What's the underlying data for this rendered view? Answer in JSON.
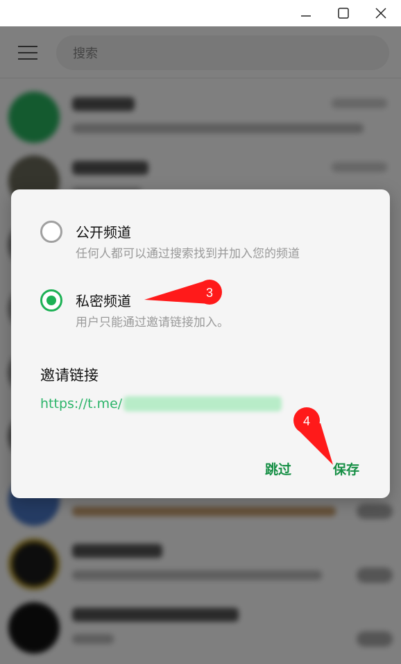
{
  "window": {
    "minimize_glyph": "—",
    "maximize_glyph": "☐",
    "close_glyph": "✕"
  },
  "app": {
    "search_placeholder": "搜索",
    "colors": {
      "accent": "#1db155",
      "link": "#2bb469",
      "button": "#168f45"
    }
  },
  "dialog": {
    "options": [
      {
        "title": "公开频道",
        "desc": "任何人都可以通过搜索找到并加入您的频道",
        "selected": false
      },
      {
        "title": "私密频道",
        "desc": "用户只能通过邀请链接加入。",
        "selected": true
      }
    ],
    "invite_link_title": "邀请链接",
    "invite_link_prefix": "https://t.me/",
    "skip_label": "跳过",
    "save_label": "保存"
  },
  "annotations": [
    {
      "number": "3",
      "color": "#ff1a1a"
    },
    {
      "number": "4",
      "color": "#ff1a1a"
    }
  ]
}
